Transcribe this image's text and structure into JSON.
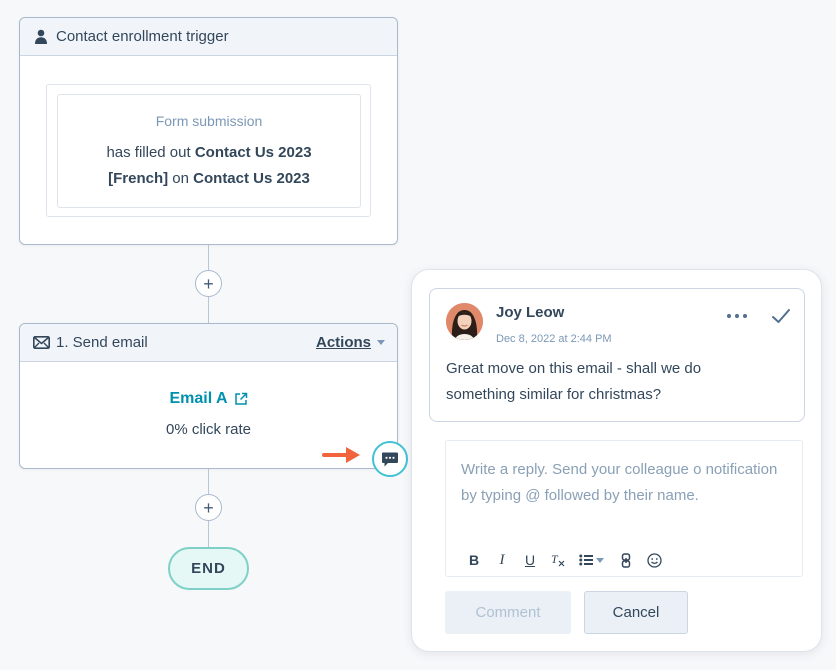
{
  "workflow": {
    "trigger": {
      "title": "Contact enrollment trigger",
      "icon": "person-icon",
      "filter_type": "Form submission",
      "filter_text_1": "has filled out",
      "filter_bold_1": "Contact Us 2023",
      "filter_bold_2": "[French]",
      "filter_text_2": "on",
      "filter_bold_3": "Contact Us 2023"
    },
    "add_step_label": "+",
    "action": {
      "title": "1. Send email",
      "icon": "envelope-icon",
      "actions_label": "Actions",
      "email_name": "Email A",
      "click_rate": "0% click rate"
    },
    "end_label": "END"
  },
  "comment_panel": {
    "comment": {
      "author": "Joy Leow",
      "timestamp": "Dec 8, 2022 at 2:44 PM",
      "text": "Great move on this email - shall we do something similar for christmas?"
    },
    "reply": {
      "placeholder": "Write a reply. Send your colleague o notification by typing @ followed by their name."
    },
    "toolbar": {
      "bold": "B",
      "italic": "I",
      "underline": "U",
      "clear_format": "Tx"
    },
    "buttons": {
      "comment": "Comment",
      "cancel": "Cancel"
    }
  },
  "colors": {
    "accent_teal": "#0091ae",
    "bubble_border": "#41c2d4",
    "arrow_orange": "#f2643b",
    "end_fill": "#e5f8f6"
  }
}
